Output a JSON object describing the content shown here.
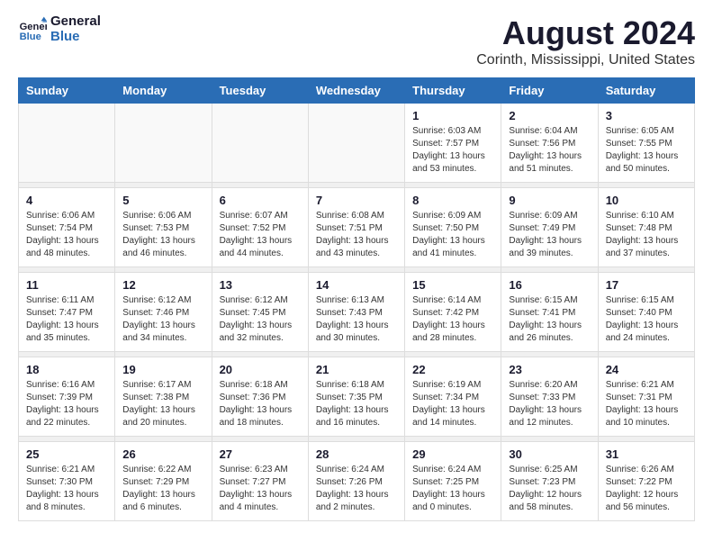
{
  "header": {
    "logo_line1": "General",
    "logo_line2": "Blue",
    "month": "August 2024",
    "location": "Corinth, Mississippi, United States"
  },
  "weekdays": [
    "Sunday",
    "Monday",
    "Tuesday",
    "Wednesday",
    "Thursday",
    "Friday",
    "Saturday"
  ],
  "weeks": [
    [
      {
        "day": "",
        "info": ""
      },
      {
        "day": "",
        "info": ""
      },
      {
        "day": "",
        "info": ""
      },
      {
        "day": "",
        "info": ""
      },
      {
        "day": "1",
        "info": "Sunrise: 6:03 AM\nSunset: 7:57 PM\nDaylight: 13 hours\nand 53 minutes."
      },
      {
        "day": "2",
        "info": "Sunrise: 6:04 AM\nSunset: 7:56 PM\nDaylight: 13 hours\nand 51 minutes."
      },
      {
        "day": "3",
        "info": "Sunrise: 6:05 AM\nSunset: 7:55 PM\nDaylight: 13 hours\nand 50 minutes."
      }
    ],
    [
      {
        "day": "4",
        "info": "Sunrise: 6:06 AM\nSunset: 7:54 PM\nDaylight: 13 hours\nand 48 minutes."
      },
      {
        "day": "5",
        "info": "Sunrise: 6:06 AM\nSunset: 7:53 PM\nDaylight: 13 hours\nand 46 minutes."
      },
      {
        "day": "6",
        "info": "Sunrise: 6:07 AM\nSunset: 7:52 PM\nDaylight: 13 hours\nand 44 minutes."
      },
      {
        "day": "7",
        "info": "Sunrise: 6:08 AM\nSunset: 7:51 PM\nDaylight: 13 hours\nand 43 minutes."
      },
      {
        "day": "8",
        "info": "Sunrise: 6:09 AM\nSunset: 7:50 PM\nDaylight: 13 hours\nand 41 minutes."
      },
      {
        "day": "9",
        "info": "Sunrise: 6:09 AM\nSunset: 7:49 PM\nDaylight: 13 hours\nand 39 minutes."
      },
      {
        "day": "10",
        "info": "Sunrise: 6:10 AM\nSunset: 7:48 PM\nDaylight: 13 hours\nand 37 minutes."
      }
    ],
    [
      {
        "day": "11",
        "info": "Sunrise: 6:11 AM\nSunset: 7:47 PM\nDaylight: 13 hours\nand 35 minutes."
      },
      {
        "day": "12",
        "info": "Sunrise: 6:12 AM\nSunset: 7:46 PM\nDaylight: 13 hours\nand 34 minutes."
      },
      {
        "day": "13",
        "info": "Sunrise: 6:12 AM\nSunset: 7:45 PM\nDaylight: 13 hours\nand 32 minutes."
      },
      {
        "day": "14",
        "info": "Sunrise: 6:13 AM\nSunset: 7:43 PM\nDaylight: 13 hours\nand 30 minutes."
      },
      {
        "day": "15",
        "info": "Sunrise: 6:14 AM\nSunset: 7:42 PM\nDaylight: 13 hours\nand 28 minutes."
      },
      {
        "day": "16",
        "info": "Sunrise: 6:15 AM\nSunset: 7:41 PM\nDaylight: 13 hours\nand 26 minutes."
      },
      {
        "day": "17",
        "info": "Sunrise: 6:15 AM\nSunset: 7:40 PM\nDaylight: 13 hours\nand 24 minutes."
      }
    ],
    [
      {
        "day": "18",
        "info": "Sunrise: 6:16 AM\nSunset: 7:39 PM\nDaylight: 13 hours\nand 22 minutes."
      },
      {
        "day": "19",
        "info": "Sunrise: 6:17 AM\nSunset: 7:38 PM\nDaylight: 13 hours\nand 20 minutes."
      },
      {
        "day": "20",
        "info": "Sunrise: 6:18 AM\nSunset: 7:36 PM\nDaylight: 13 hours\nand 18 minutes."
      },
      {
        "day": "21",
        "info": "Sunrise: 6:18 AM\nSunset: 7:35 PM\nDaylight: 13 hours\nand 16 minutes."
      },
      {
        "day": "22",
        "info": "Sunrise: 6:19 AM\nSunset: 7:34 PM\nDaylight: 13 hours\nand 14 minutes."
      },
      {
        "day": "23",
        "info": "Sunrise: 6:20 AM\nSunset: 7:33 PM\nDaylight: 13 hours\nand 12 minutes."
      },
      {
        "day": "24",
        "info": "Sunrise: 6:21 AM\nSunset: 7:31 PM\nDaylight: 13 hours\nand 10 minutes."
      }
    ],
    [
      {
        "day": "25",
        "info": "Sunrise: 6:21 AM\nSunset: 7:30 PM\nDaylight: 13 hours\nand 8 minutes."
      },
      {
        "day": "26",
        "info": "Sunrise: 6:22 AM\nSunset: 7:29 PM\nDaylight: 13 hours\nand 6 minutes."
      },
      {
        "day": "27",
        "info": "Sunrise: 6:23 AM\nSunset: 7:27 PM\nDaylight: 13 hours\nand 4 minutes."
      },
      {
        "day": "28",
        "info": "Sunrise: 6:24 AM\nSunset: 7:26 PM\nDaylight: 13 hours\nand 2 minutes."
      },
      {
        "day": "29",
        "info": "Sunrise: 6:24 AM\nSunset: 7:25 PM\nDaylight: 13 hours\nand 0 minutes."
      },
      {
        "day": "30",
        "info": "Sunrise: 6:25 AM\nSunset: 7:23 PM\nDaylight: 12 hours\nand 58 minutes."
      },
      {
        "day": "31",
        "info": "Sunrise: 6:26 AM\nSunset: 7:22 PM\nDaylight: 12 hours\nand 56 minutes."
      }
    ]
  ]
}
